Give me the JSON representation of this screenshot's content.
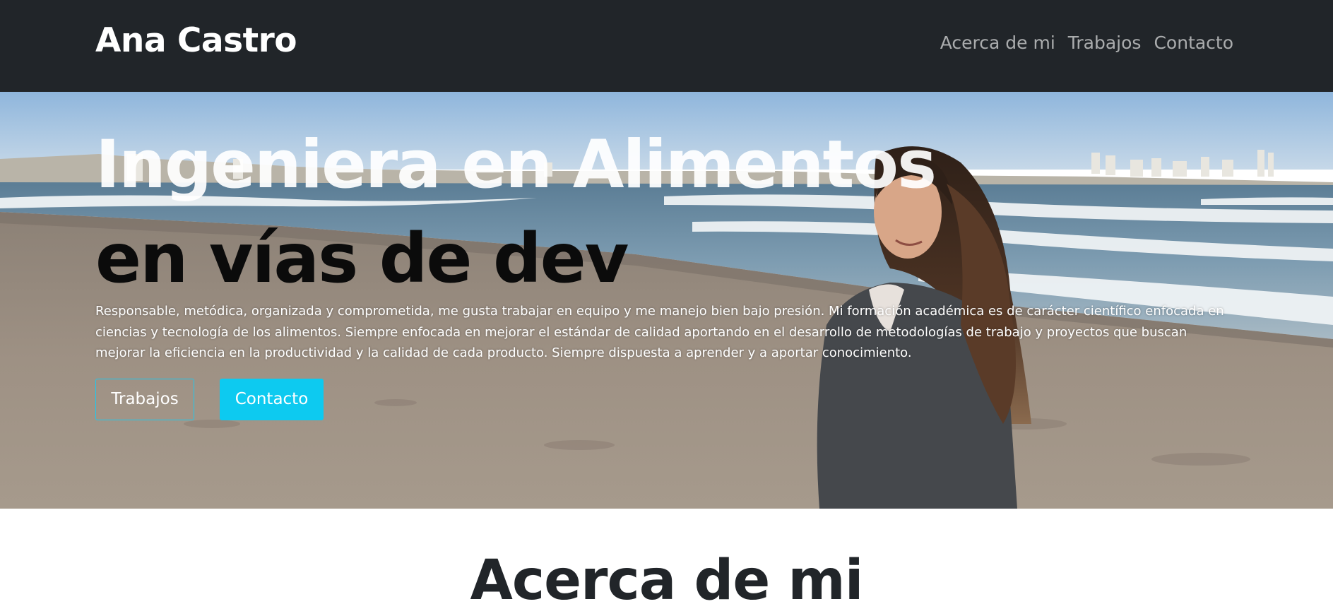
{
  "navbar": {
    "brand": "Ana Castro",
    "links": [
      "Acerca de mi",
      "Trabajos",
      "Contacto"
    ]
  },
  "hero": {
    "headline_line1": "Ingeniera en Alimentos",
    "headline_line2": "en vías de dev",
    "description": "Responsable, metódica, organizada y comprometida, me gusta trabajar en equipo y me manejo bien bajo presión. Mi formación académica es de carácter científico enfocada en ciencias y tecnología de los alimentos. Siempre enfocada en mejorar el estándar de calidad aportando en el desarrollo de metodologías de trabajo y proyectos que buscan mejorar la eficiencia en la productividad y la calidad de cada producto. Siempre dispuesta a aprender y a aportar conocimiento.",
    "buttons": {
      "works": "Trabajos",
      "contact": "Contacto"
    }
  },
  "about": {
    "title": "Acerca de mi"
  },
  "colors": {
    "navbar_bg": "#212529",
    "accent": "#0dcaf0",
    "heading_dark": "#212529"
  }
}
